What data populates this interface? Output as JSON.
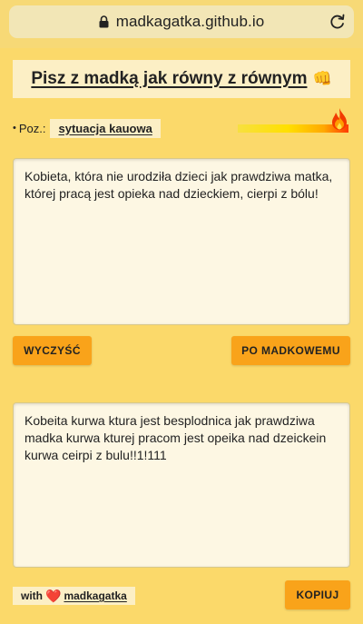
{
  "browser": {
    "url": "madkagatka.github.io",
    "lock_icon": "lock-icon",
    "reload_icon": "reload-icon"
  },
  "header": {
    "title": "Pisz z madką jak równy z równym",
    "title_icon": "👊"
  },
  "level": {
    "label": "Poz.:",
    "value": "sytuacja kauowa",
    "meter_icon": "fire-icon",
    "meter_fill": 1.0
  },
  "input": {
    "text": "Kobieta, która nie urodziła dzieci jak prawdziwa matka, której pracą jest opieka nad dzieckiem, cierpi z bólu!"
  },
  "buttons": {
    "clear": "WYCZYŚĆ",
    "convert": "PO MADKOWEMU",
    "copy": "KOPIUJ"
  },
  "output": {
    "text": "Kobeita kurwa ktura jest besplodnica jak prawdziwa madka kurwa kturej pracom jest opeika nad dzeickein kurwa ceirpi z bulu!!1!111"
  },
  "footer": {
    "with_label": "with",
    "heart": "❤️",
    "author": "madkagatka"
  },
  "colors": {
    "background": "#fbd96a",
    "panel": "#fcefc5",
    "button": "#f9a31a",
    "textarea": "#fdf7e3"
  }
}
